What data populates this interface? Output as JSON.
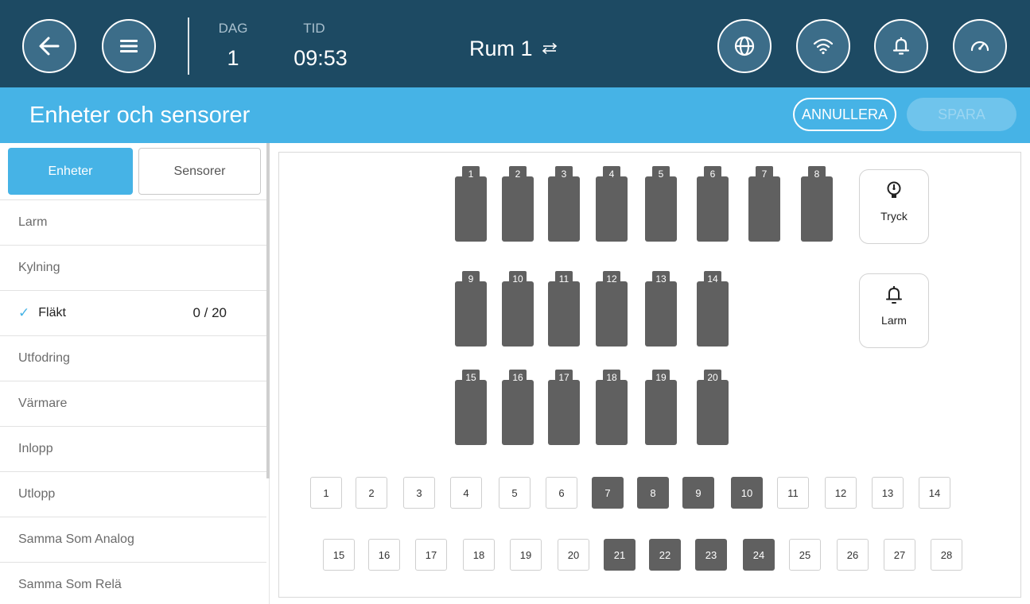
{
  "header": {
    "day_caption": "DAG",
    "day_value": "1",
    "time_caption": "TID",
    "time_value": "09:53",
    "room": "Rum 1"
  },
  "title_bar": {
    "title": "Enheter och sensorer",
    "cancel_label": "ANNULLERA",
    "save_label": "SPARA"
  },
  "sidebar": {
    "tabs": [
      "Enheter",
      "Sensorer"
    ],
    "items": [
      {
        "label": "Larm"
      },
      {
        "label": "Kylning"
      },
      {
        "label": "Fläkt",
        "count": "0 / 20",
        "checked": true
      },
      {
        "label": "Utfodring"
      },
      {
        "label": "Värmare"
      },
      {
        "label": "Inlopp"
      },
      {
        "label": "Utlopp"
      },
      {
        "label": "Samma Som Analog"
      },
      {
        "label": "Samma Som Relä"
      }
    ]
  },
  "fans": {
    "row1": [
      "1",
      "2",
      "3",
      "4",
      "5",
      "6",
      "7",
      "8"
    ],
    "row2": [
      "9",
      "10",
      "11",
      "12",
      "13",
      "14"
    ],
    "row3": [
      "15",
      "16",
      "17",
      "18",
      "19",
      "20"
    ]
  },
  "side_cards": {
    "pressure_label": "Tryck",
    "alarm_label": "Larm"
  },
  "ports": {
    "row1": [
      "1",
      "2",
      "3",
      "4",
      "5",
      "6",
      "7",
      "8",
      "9",
      "10",
      "11",
      "12",
      "13",
      "14"
    ],
    "row2": [
      "15",
      "16",
      "17",
      "18",
      "19",
      "20",
      "21",
      "22",
      "23",
      "24",
      "25",
      "26",
      "27",
      "28"
    ],
    "active": [
      "7",
      "8",
      "9",
      "10",
      "21",
      "22",
      "23",
      "24"
    ]
  },
  "colors": {
    "header_bg": "#1d4a63",
    "accent": "#46b3e6",
    "device_fill": "#606060"
  },
  "icons": {
    "back": "arrow-left-icon",
    "menu": "hamburger-menu-icon",
    "globe": "globe-icon",
    "wifi": "wifi-icon",
    "bell": "bell-icon",
    "gauge": "gauge-icon",
    "swap": "swap-arrows-icon",
    "pressure": "pressure-sensor-icon",
    "check": "checkmark-icon"
  }
}
